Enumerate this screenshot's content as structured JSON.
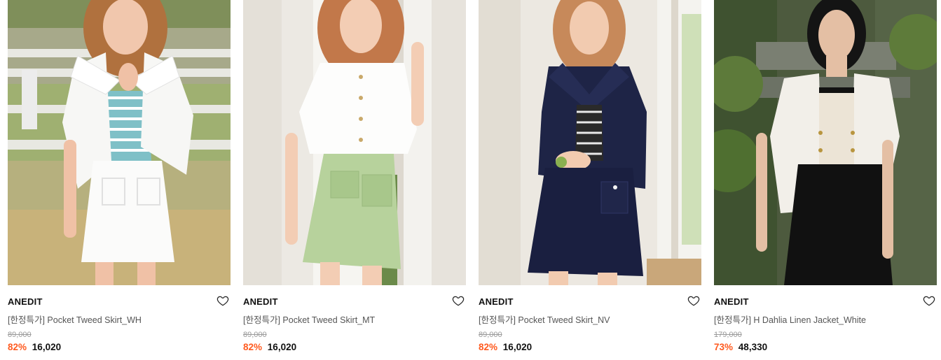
{
  "products": [
    {
      "brand": "ANEDIT",
      "name": "[한정특가] Pocket Tweed Skirt_WH",
      "original_price": "89,000",
      "discount": "82%",
      "price": "16,020",
      "image_label": "model wearing white collared jacket and white tweed skirt outdoors"
    },
    {
      "brand": "ANEDIT",
      "name": "[한정특가] Pocket Tweed Skirt_MT",
      "original_price": "89,000",
      "discount": "82%",
      "price": "16,020",
      "image_label": "model wearing white blouse and mint tweed skirt by window"
    },
    {
      "brand": "ANEDIT",
      "name": "[한정특가] Pocket Tweed Skirt_NV",
      "original_price": "89,000",
      "discount": "82%",
      "price": "16,020",
      "image_label": "model wearing navy collared jacket and navy tweed skirt by window"
    },
    {
      "brand": "ANEDIT",
      "name": "[한정특가] H Dahlia Linen Jacket_White",
      "original_price": "179,000",
      "discount": "73%",
      "price": "48,330",
      "image_label": "model wearing white linen jacket and black skirt in garden"
    }
  ],
  "colors": {
    "discount": "#ff5a1f",
    "strikethrough": "#9a9a9a",
    "text": "#111111",
    "subtext": "#555555"
  },
  "icons": {
    "wishlist": "heart-outline-icon"
  }
}
